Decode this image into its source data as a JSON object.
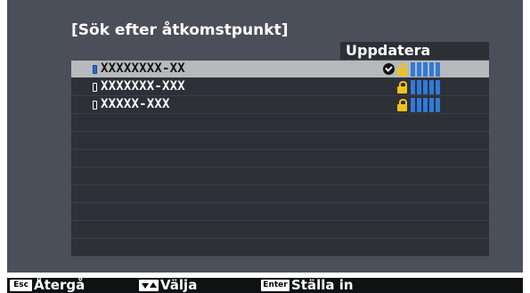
{
  "title": "[Sök efter åtkomstpunkt]",
  "refresh_label": "Uppdatera",
  "access_points": [
    {
      "ssid": "XXXXXXXX-XX",
      "selected": true,
      "connected": true,
      "secured": true,
      "signal_bars": 5
    },
    {
      "ssid": "XXXXXXX-XXX",
      "selected": false,
      "connected": false,
      "secured": true,
      "signal_bars": 5
    },
    {
      "ssid": "XXXXX-XXX",
      "selected": false,
      "connected": false,
      "secured": true,
      "signal_bars": 5
    }
  ],
  "footer": {
    "esc_key": "Esc",
    "back_label": "Återgå",
    "arrows_key_icon": "up-down-arrows-icon",
    "select_label": "Välja",
    "enter_key": "Enter",
    "set_label": "Ställa in"
  },
  "colors": {
    "screen_bg": "#4b4f59",
    "list_bg": "#2e3037",
    "selection": "#b7b9bc",
    "lock": "#f0c21c",
    "signal": "#2f7ad8"
  }
}
